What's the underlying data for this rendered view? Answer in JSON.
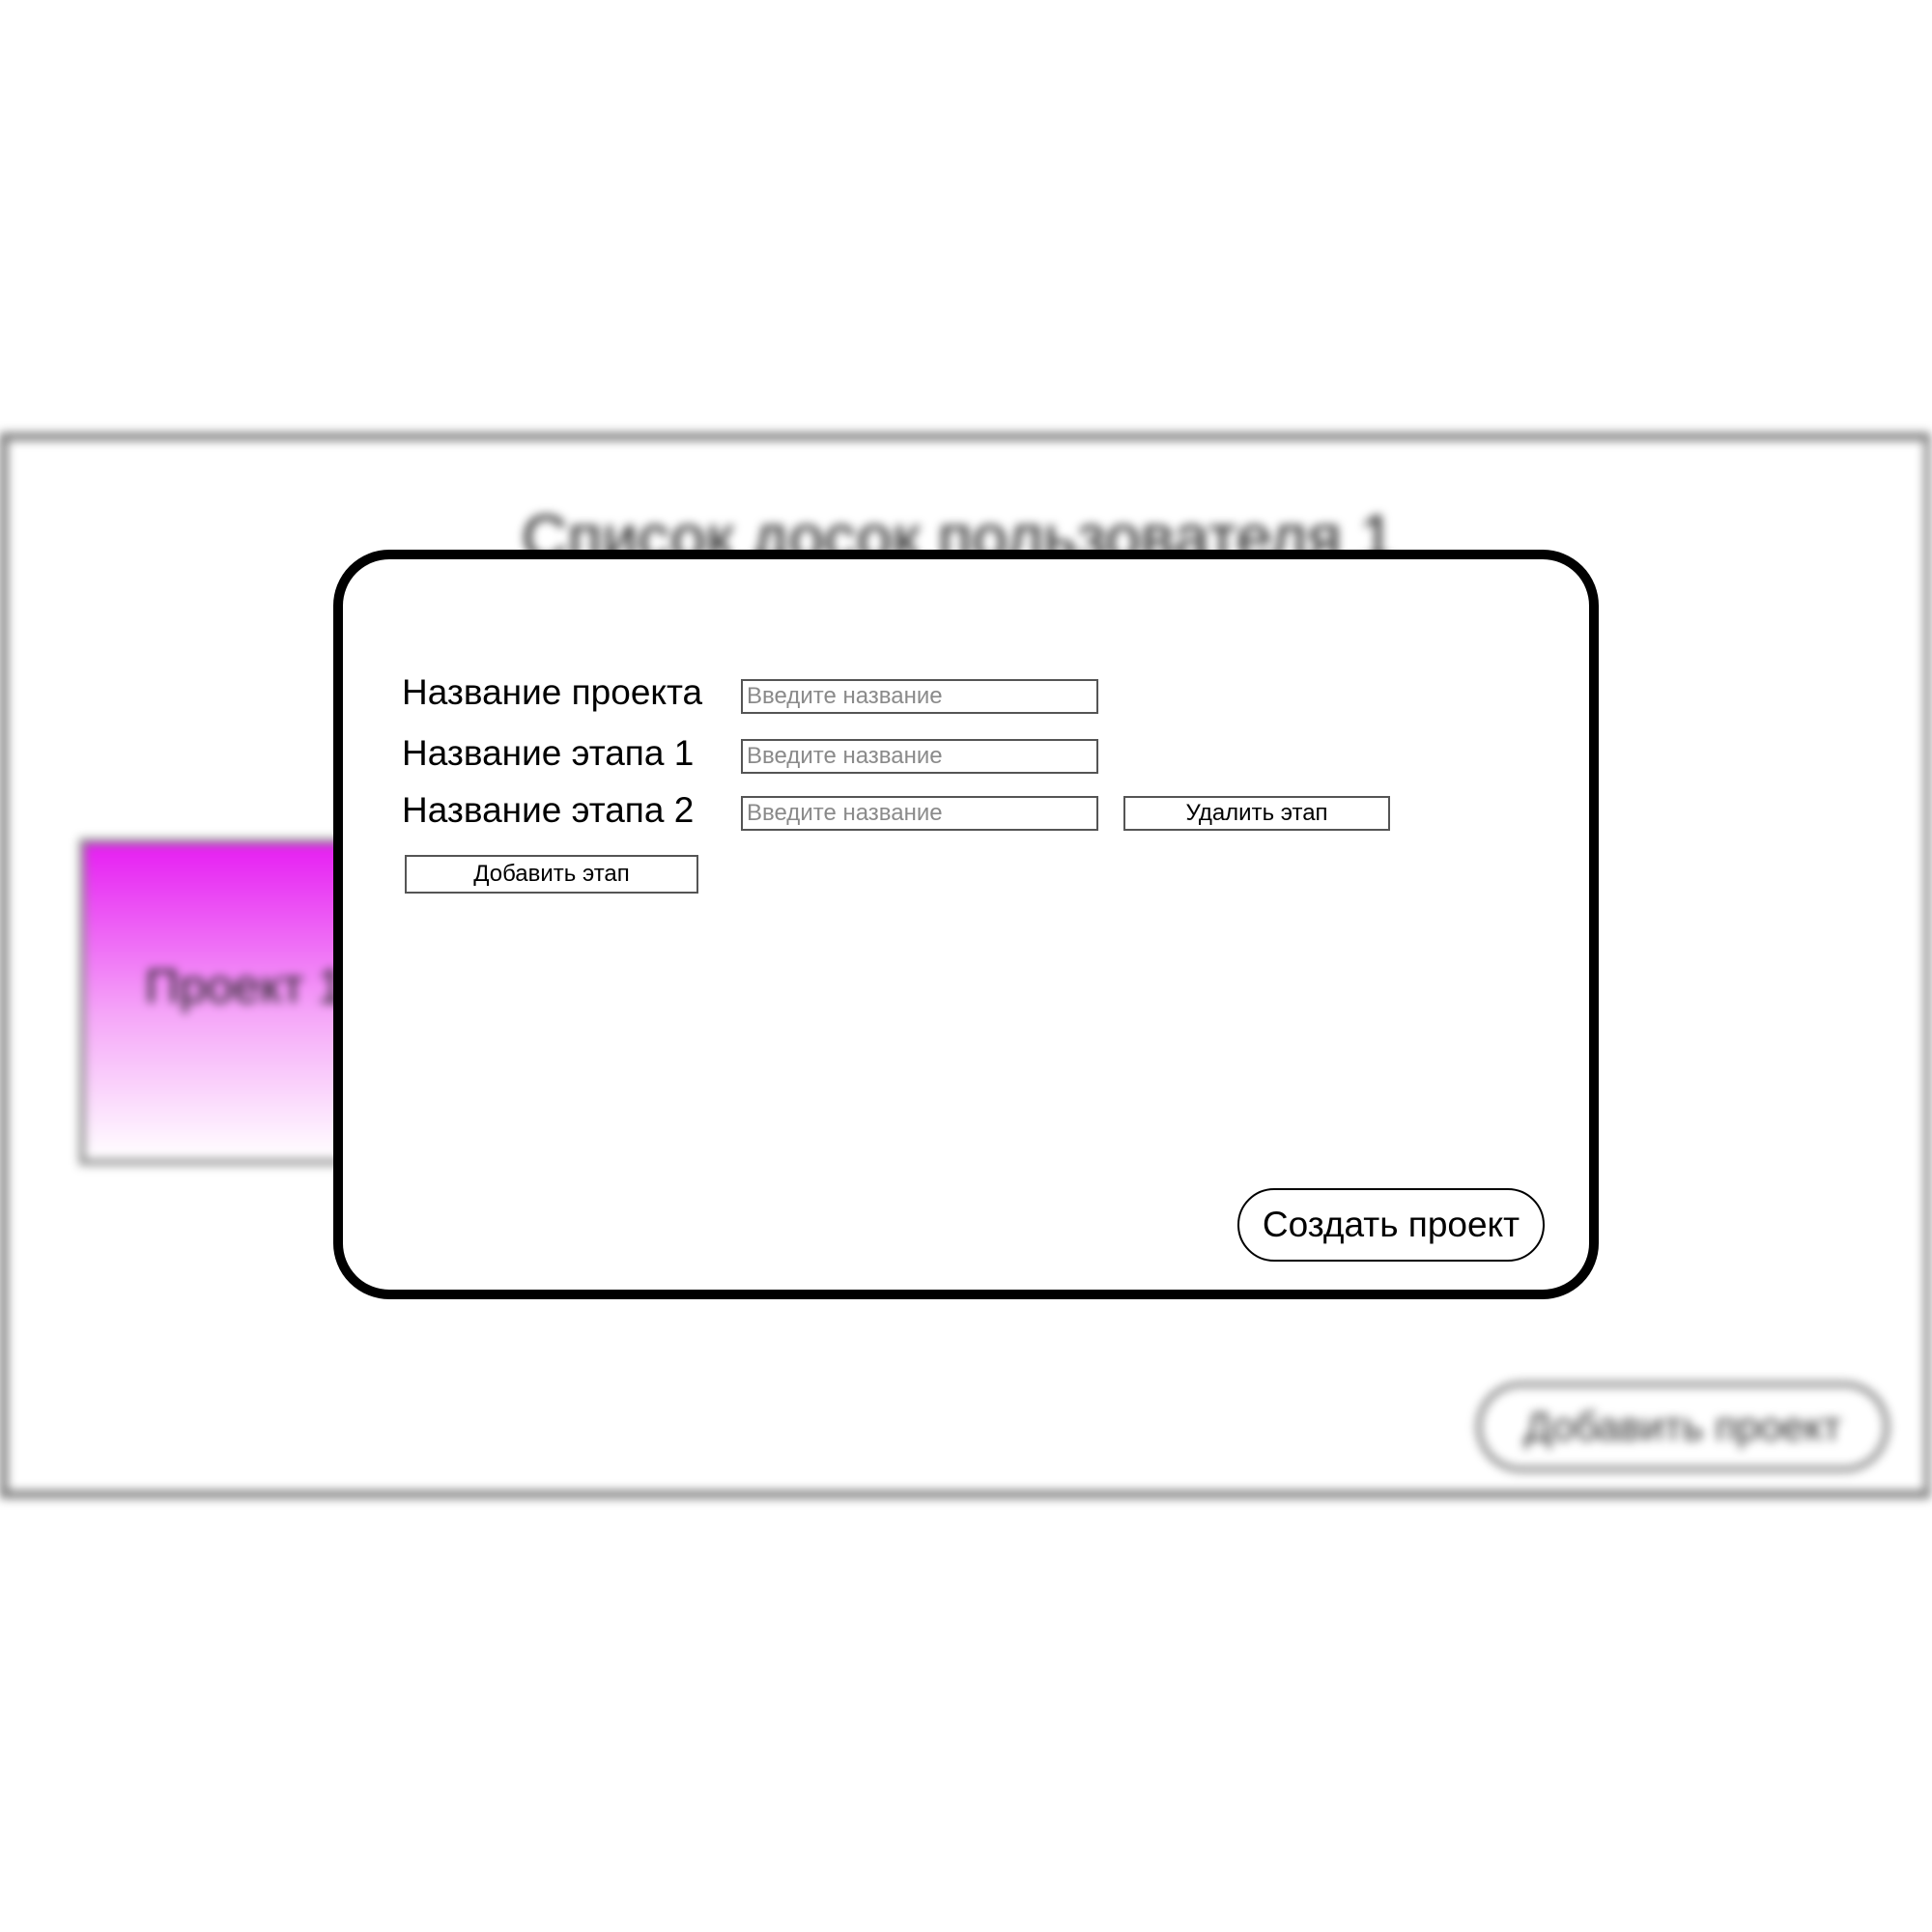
{
  "background": {
    "title": "Список досок пользователя 1",
    "project_card_label": "Проект 1",
    "project_card_color": "#e61ef2",
    "add_project_label": "Добавить проект"
  },
  "modal": {
    "project_name_label": "Название проекта",
    "project_name_placeholder": "Введите название",
    "stages": [
      {
        "label": "Название этапа 1",
        "placeholder": "Введите название"
      },
      {
        "label": "Название этапа 2",
        "placeholder": "Введите название",
        "delete_label": "Удалить этап"
      }
    ],
    "add_stage_label": "Добавить этап",
    "create_project_label": "Создать проект"
  }
}
